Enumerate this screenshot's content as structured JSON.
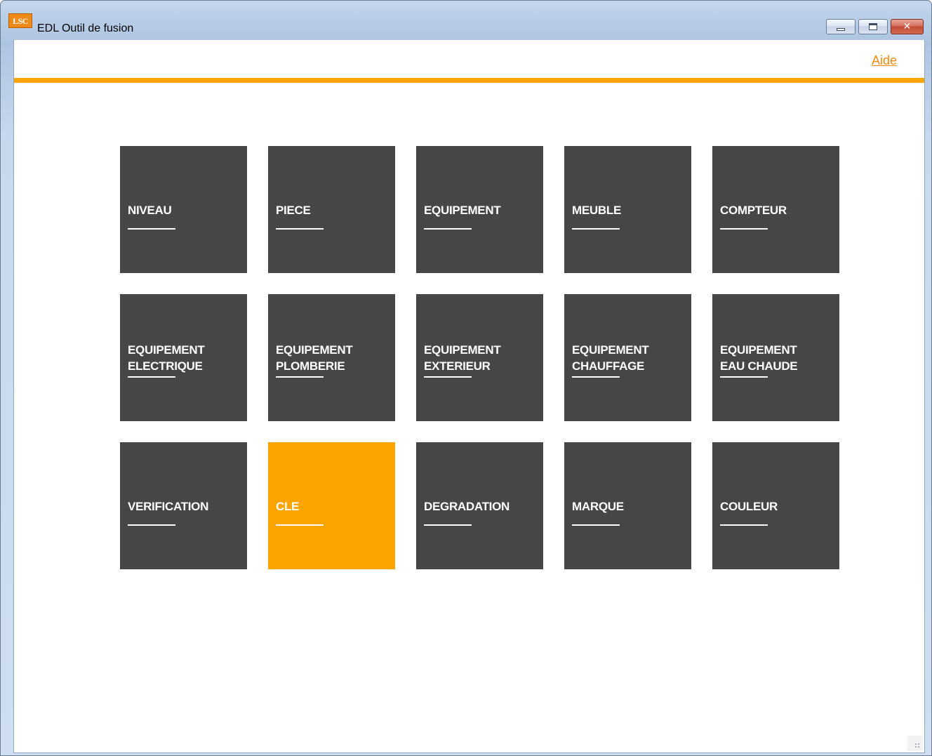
{
  "window": {
    "icon_text": "LSC",
    "title": "EDL Outil de fusion"
  },
  "header": {
    "help_link": "Aide",
    "accent_color": "#fca400"
  },
  "tiles": [
    {
      "label": "NIVEAU",
      "active": false
    },
    {
      "label": "PIECE",
      "active": false
    },
    {
      "label": "EQUIPEMENT",
      "active": false
    },
    {
      "label": "MEUBLE",
      "active": false
    },
    {
      "label": "COMPTEUR",
      "active": false
    },
    {
      "label": "EQUIPEMENT\nELECTRIQUE",
      "active": false
    },
    {
      "label": "EQUIPEMENT\nPLOMBERIE",
      "active": false
    },
    {
      "label": "EQUIPEMENT\nEXTERIEUR",
      "active": false
    },
    {
      "label": "EQUIPEMENT\nCHAUFFAGE",
      "active": false
    },
    {
      "label": "EQUIPEMENT\nEAU CHAUDE",
      "active": false
    },
    {
      "label": "VERIFICATION",
      "active": false
    },
    {
      "label": "CLE",
      "active": true
    },
    {
      "label": "DEGRADATION",
      "active": false
    },
    {
      "label": "MARQUE",
      "active": false
    },
    {
      "label": "COULEUR",
      "active": false
    }
  ],
  "colors": {
    "tile_default": "#464646",
    "tile_active": "#fca400",
    "link": "#f58a0b"
  }
}
